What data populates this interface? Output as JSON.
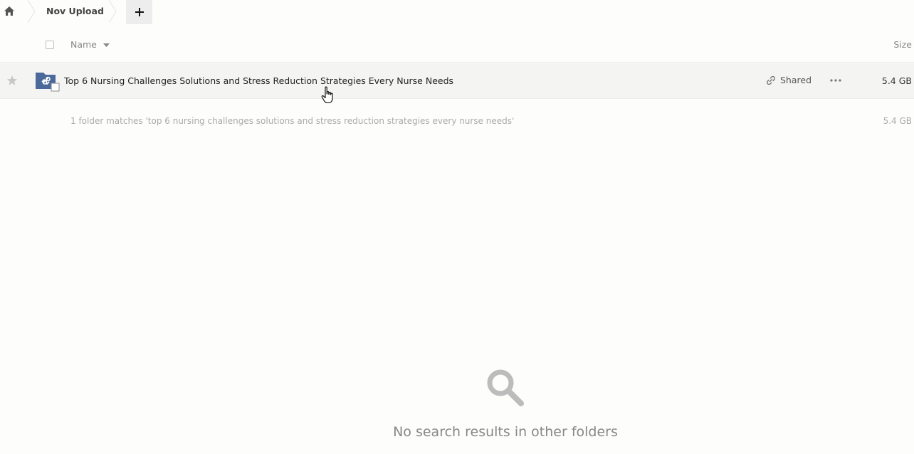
{
  "breadcrumb": {
    "home_icon": "home-icon",
    "current": "Nov Upload",
    "add_icon": "plus-icon"
  },
  "header": {
    "name_label": "Name",
    "size_label": "Size"
  },
  "files": [
    {
      "name": "Top 6 Nursing Challenges Solutions and Stress Reduction Strategies Every Nurse Needs",
      "type": "shared-folder",
      "shared_label": "Shared",
      "size": "5.4 GB"
    }
  ],
  "summary": {
    "text": "1 folder matches 'top 6 nursing challenges solutions and stress reduction strategies every nurse needs'",
    "size": "5.4 GB"
  },
  "empty_state": {
    "icon": "search-icon",
    "text": "No search results in other folders"
  },
  "colors": {
    "background": "#fdfdfb",
    "row_hover": "#f4f4f2",
    "folder_blue": "#4b6a9b",
    "muted_text": "#888888"
  }
}
